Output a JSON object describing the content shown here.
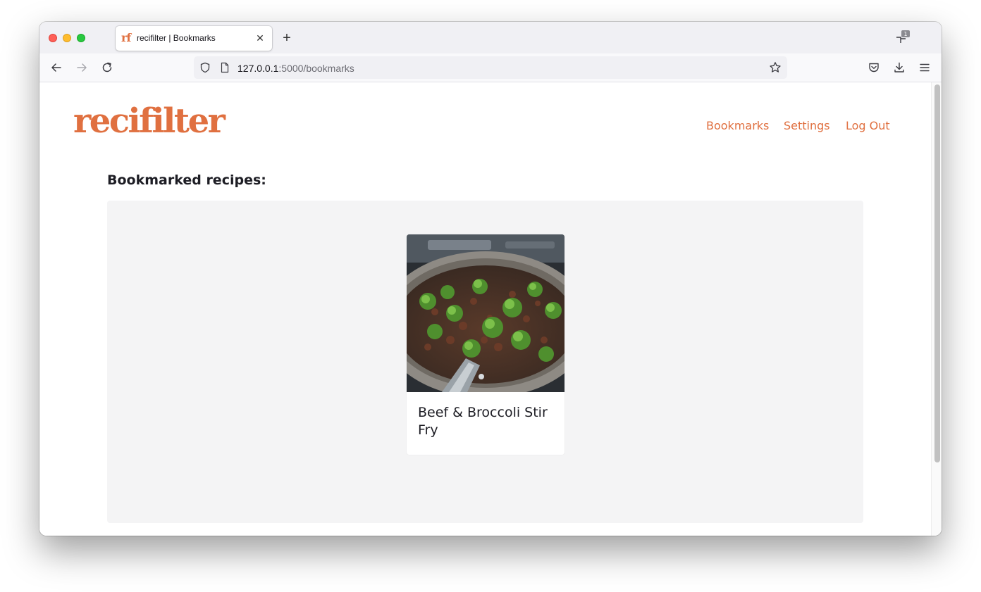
{
  "browser": {
    "tab": {
      "favicon_text": "rf",
      "title": "recifilter | Bookmarks"
    },
    "tabs_overview_count": "1",
    "url": {
      "host": "127.0.0.1",
      "path": ":5000/bookmarks"
    }
  },
  "site": {
    "logo": "recifilter",
    "nav": [
      "Bookmarks",
      "Settings",
      "Log Out"
    ],
    "brand_color": "#e07040"
  },
  "page": {
    "heading": "Bookmarked recipes:",
    "recipes": [
      {
        "title": "Beef & Broccoli Stir Fry",
        "image": "beef-broccoli-pan-photo"
      }
    ]
  }
}
